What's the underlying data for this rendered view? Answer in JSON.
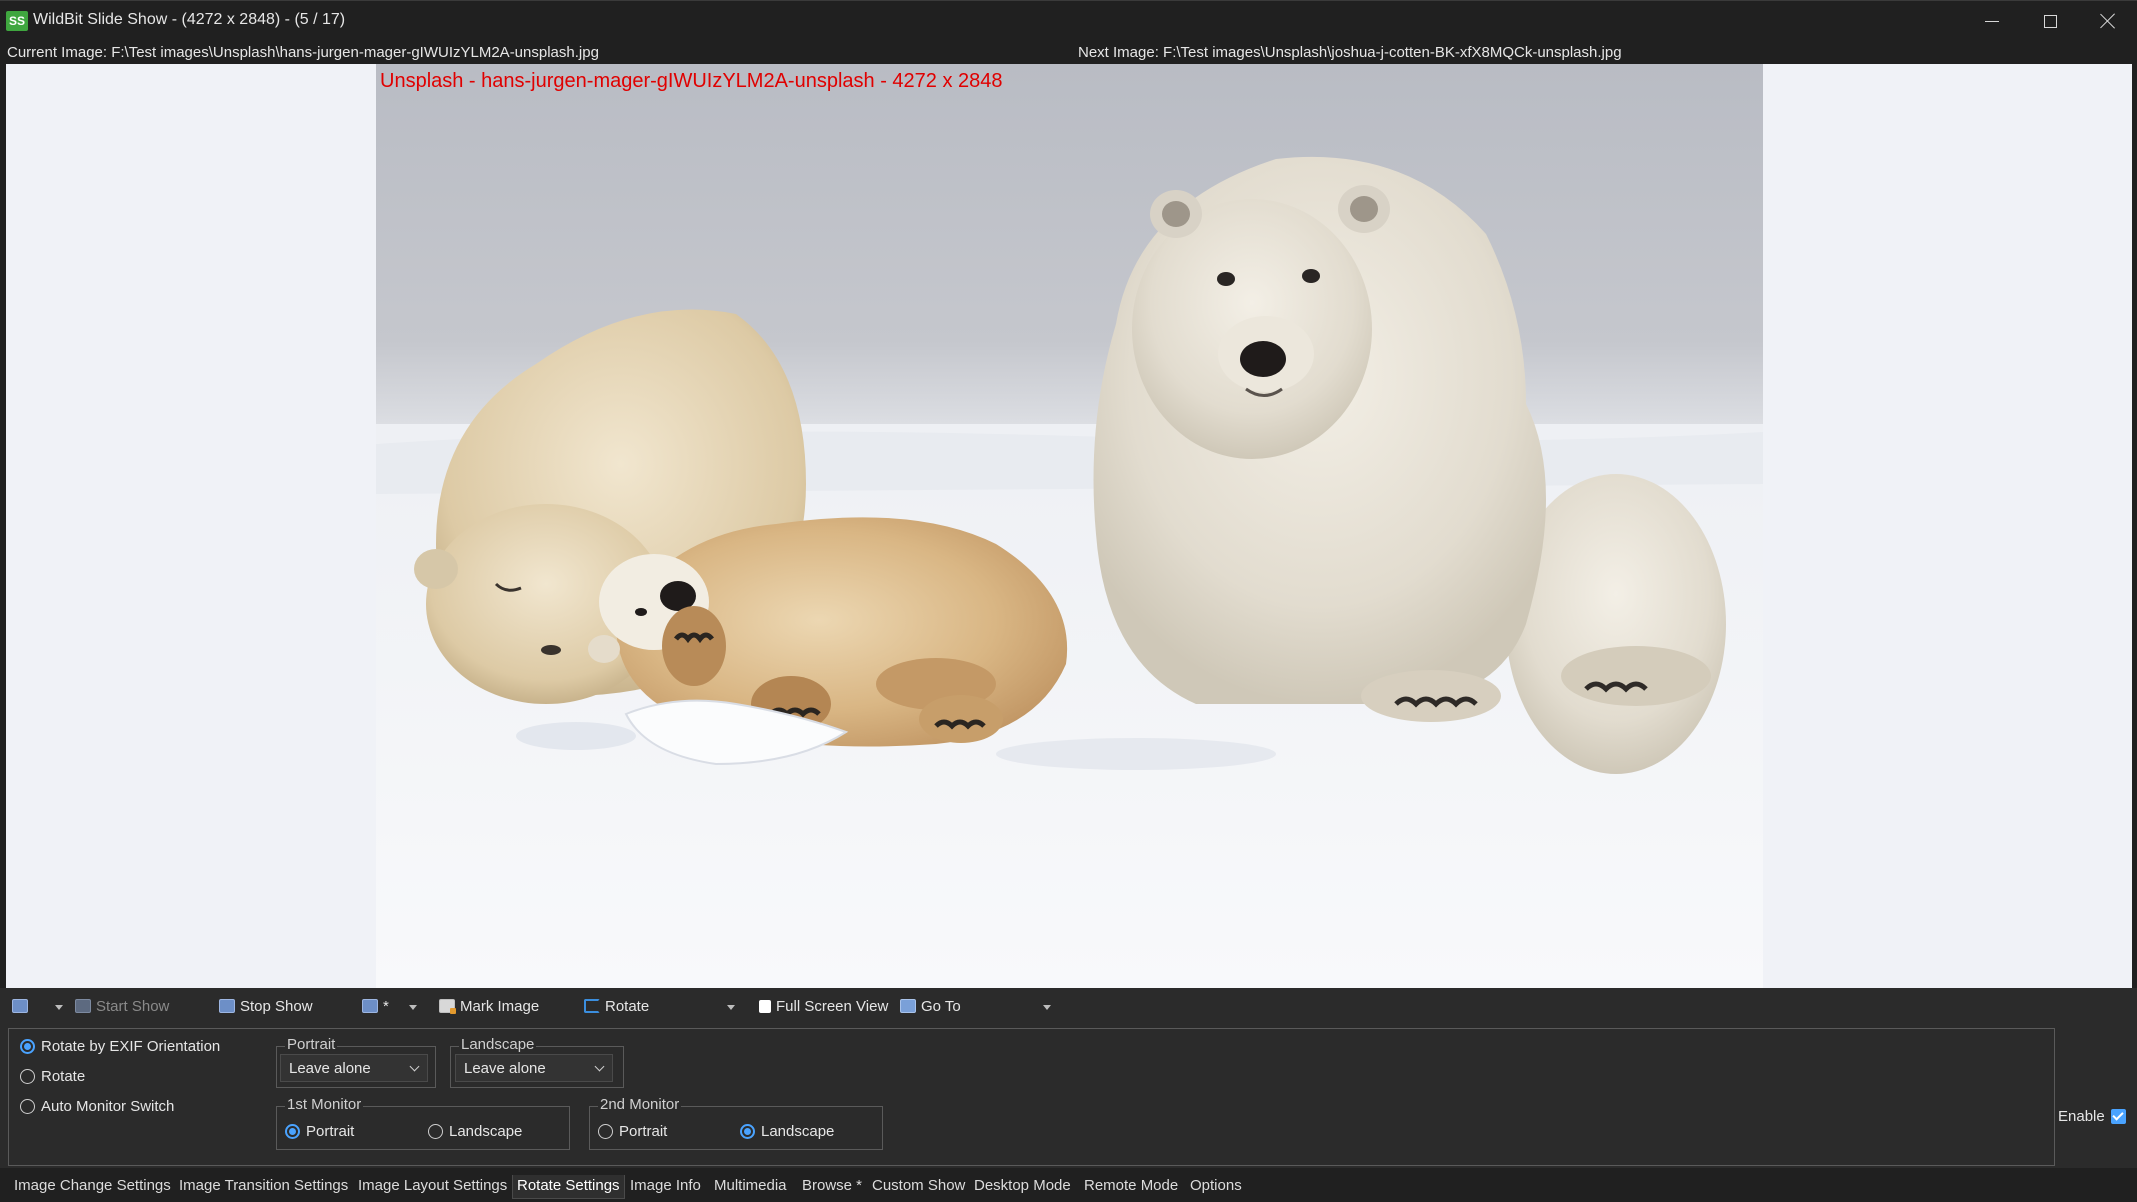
{
  "window": {
    "title": "WildBit Slide Show - (4272 x 2848) - (5 / 17)",
    "app_icon_text": "SS"
  },
  "paths": {
    "current": "Current Image: F:\\Test images\\Unsplash\\hans-jurgen-mager-gIWUIzYLM2A-unsplash.jpg",
    "next": "Next Image: F:\\Test images\\Unsplash\\joshua-j-cotten-BK-xfX8MQCk-unsplash.jpg"
  },
  "display": {
    "overlay_caption": "Unsplash - hans-jurgen-mager-gIWUIzYLM2A-unsplash - 4272 x 2848"
  },
  "toolbar": {
    "start_show": "Start Show",
    "stop_show": "Stop Show",
    "star_label": "*",
    "mark_image": "Mark Image",
    "rotate": "Rotate",
    "full_screen": "Full Screen View",
    "go_to": "Go To"
  },
  "rotate_settings": {
    "modes": [
      {
        "label": "Rotate by EXIF Orientation",
        "selected": true
      },
      {
        "label": "Rotate",
        "selected": false
      },
      {
        "label": "Auto Monitor Switch",
        "selected": false
      }
    ],
    "portrait": {
      "label": "Portrait",
      "value": "Leave alone"
    },
    "landscape": {
      "label": "Landscape",
      "value": "Leave alone"
    },
    "monitor1": {
      "label": "1st Monitor",
      "options": [
        "Portrait",
        "Landscape"
      ],
      "selected": "Portrait"
    },
    "monitor2": {
      "label": "2nd Monitor",
      "options": [
        "Portrait",
        "Landscape"
      ],
      "selected": "Landscape"
    },
    "enable": {
      "label": "Enable",
      "checked": true
    }
  },
  "tabs": [
    {
      "label": "Image Change Settings",
      "active": false
    },
    {
      "label": "Image Transition Settings",
      "active": false
    },
    {
      "label": "Image Layout Settings",
      "active": false
    },
    {
      "label": "Rotate Settings",
      "active": true
    },
    {
      "label": "Image Info",
      "active": false
    },
    {
      "label": "Multimedia",
      "active": false
    },
    {
      "label": "Browse *",
      "active": false
    },
    {
      "label": "Custom Show",
      "active": false
    },
    {
      "label": "Desktop Mode",
      "active": false
    },
    {
      "label": "Remote Mode",
      "active": false
    },
    {
      "label": "Options",
      "active": false
    }
  ],
  "colors": {
    "accent": "#4aa3ff",
    "caption_red": "#e00000",
    "window_bg": "#202020",
    "panel_bg": "#2b2b2b"
  },
  "icons": [
    "app-icon",
    "minimize-icon",
    "maximize-icon",
    "close-icon",
    "slideshow-screen-icon",
    "start-show-icon",
    "stop-show-icon",
    "mark-image-icon",
    "rotate-icon",
    "full-screen-icon",
    "go-to-icon",
    "chevron-down-icon"
  ]
}
